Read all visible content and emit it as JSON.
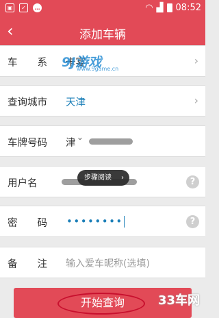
{
  "status_bar": {
    "time": "08:52"
  },
  "header": {
    "back_icon": "chevron-left-icon",
    "title": "添加车辆"
  },
  "form": {
    "series": {
      "label": "车　　系",
      "value": "卡宴"
    },
    "city": {
      "label": "查询城市",
      "value": "天津"
    },
    "plate": {
      "label": "车牌号码",
      "prefix": "津"
    },
    "username": {
      "label": "用户名"
    },
    "password": {
      "label": "密　　码",
      "value": "••••••••"
    },
    "remark": {
      "label": "备　　注",
      "placeholder": "输入爱车昵称(选填)"
    }
  },
  "tooltip": {
    "text": "步骤阅读"
  },
  "submit": {
    "label": "开始查询"
  },
  "watermarks": {
    "top": "9J游戏",
    "top_sub": "www.9game.cn",
    "bottom": "33车网"
  },
  "colors": {
    "brand": "#e24a57",
    "link_blue": "#1b7fb8"
  }
}
